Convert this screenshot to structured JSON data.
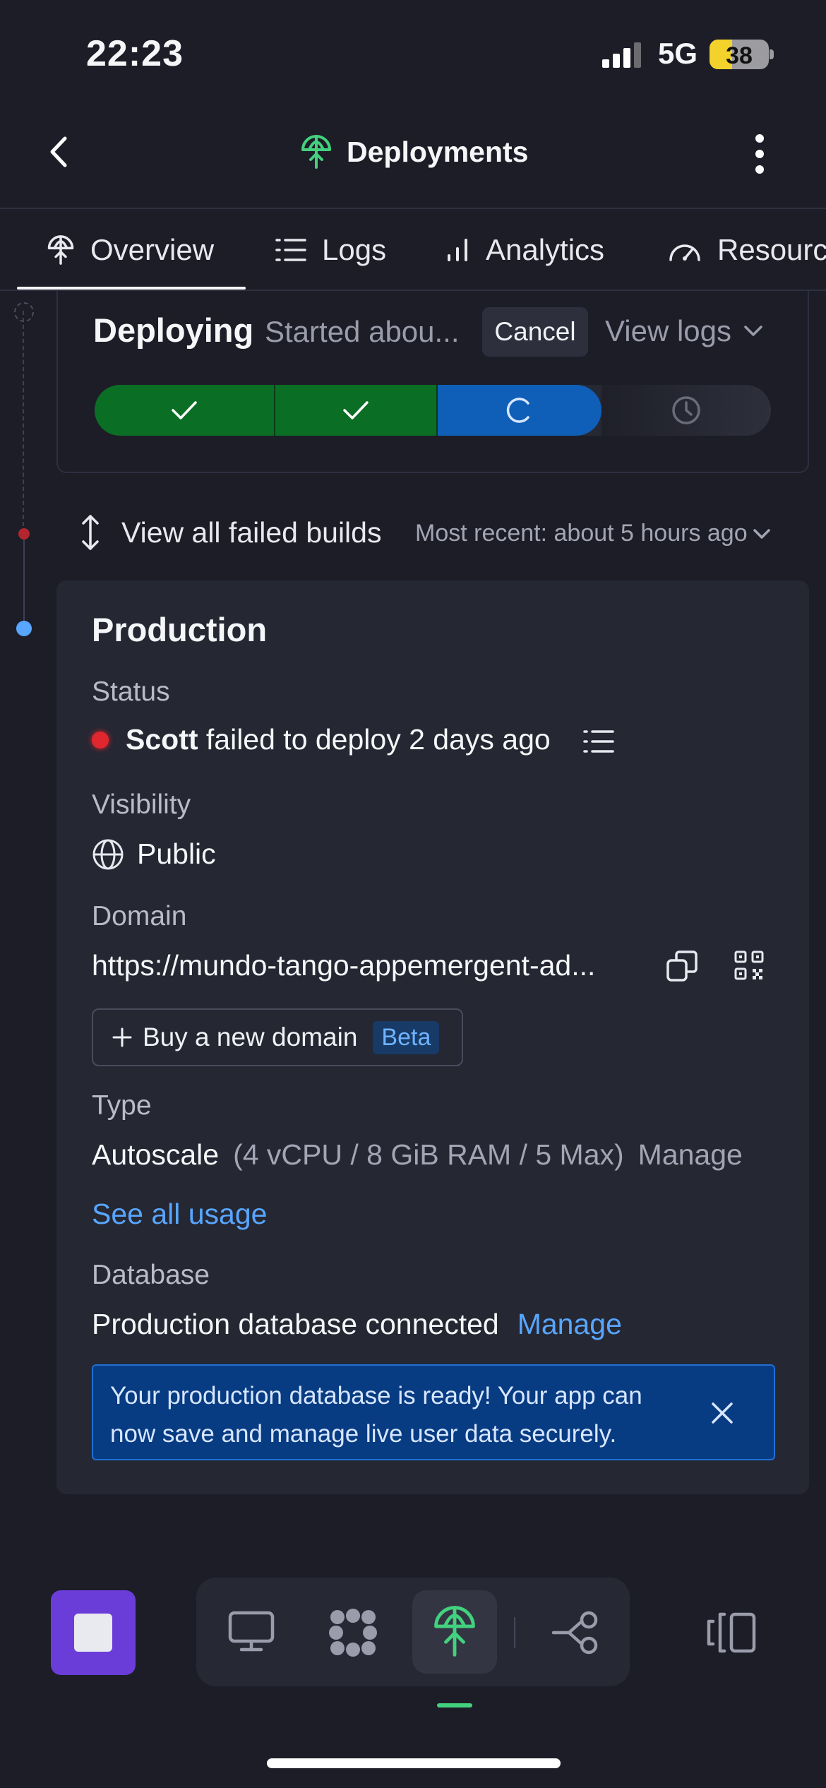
{
  "status_bar": {
    "time": "22:23",
    "network": "5G",
    "battery": "38"
  },
  "header": {
    "title": "Deployments"
  },
  "tabs": [
    {
      "label": "Overview"
    },
    {
      "label": "Logs"
    },
    {
      "label": "Analytics"
    },
    {
      "label": "Resourc"
    }
  ],
  "deploying": {
    "title": "Deploying",
    "subtitle": "Started abou...",
    "cancel_label": "Cancel",
    "view_logs_label": "View logs",
    "steps": [
      "complete",
      "complete",
      "in-progress",
      "pending"
    ]
  },
  "failed_builds": {
    "label": "View all failed builds",
    "recent": "Most recent: about 5 hours ago"
  },
  "production": {
    "title": "Production",
    "status_label": "Status",
    "status_user": "Scott",
    "status_text": " failed to deploy 2 days ago",
    "visibility_label": "Visibility",
    "visibility_value": "Public",
    "domain_label": "Domain",
    "domain_value": "https://mundo-tango-appemergent-ad...",
    "buy_domain_label": "Buy a new domain",
    "beta_label": "Beta",
    "type_label": "Type",
    "type_value": "Autoscale",
    "type_spec": "(4 vCPU / 8 GiB RAM / 5 Max)",
    "type_manage": "Manage",
    "see_usage": "See all usage",
    "database_label": "Database",
    "database_value": "Production database connected",
    "database_manage": "Manage",
    "banner_text": "Your production database is ready! Your app can now save and manage live user data securely."
  },
  "colors": {
    "background": "#1c1d27",
    "card": "#252733",
    "accent_blue": "#58a6ff",
    "success_green": "#0b6e25",
    "progress_blue": "#0f5fb8",
    "error_red": "#e0262e",
    "stop_purple": "#6a3dd8",
    "nav_active": "#43d17e"
  },
  "icons": {
    "back": "chevron-left-icon",
    "deployments": "deploy-icon",
    "more": "more-vertical-icon",
    "overview": "deploy-icon",
    "logs": "list-icon",
    "analytics": "bar-chart-icon",
    "resources": "gauge-icon",
    "failed_builds": "expand-vertical-icon",
    "visibility": "globe-icon",
    "copy": "copy-icon",
    "qr": "qr-code-icon",
    "nav": [
      "monitor-icon",
      "apps-icon",
      "deploy-icon",
      "workflow-icon",
      "panel-toggle-icon"
    ]
  }
}
